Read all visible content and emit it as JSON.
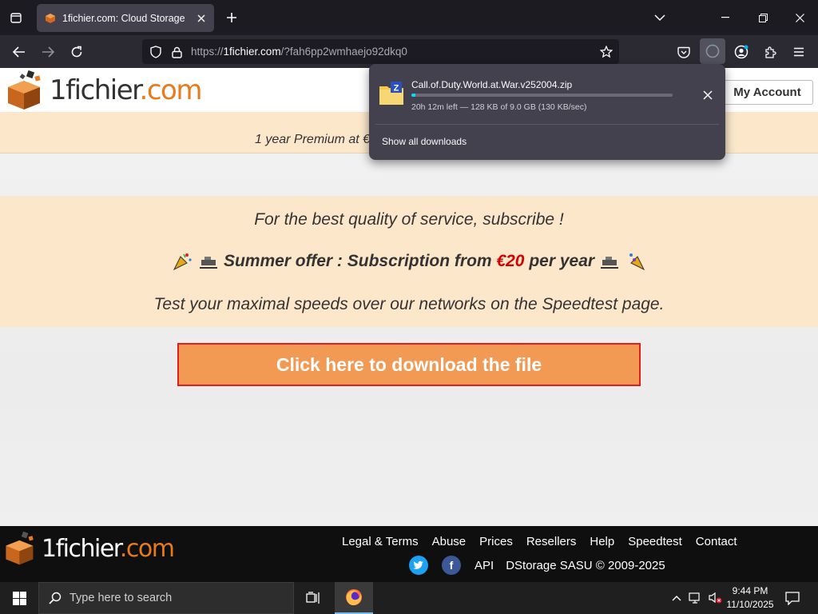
{
  "browser": {
    "tab_title": "1fichier.com: Cloud Storage",
    "url_prefix": "https://",
    "url_host": "1fichier.com",
    "url_path": "/?fah6pp2wmhaejo92dkq0"
  },
  "site": {
    "logo_one": "1",
    "logo_fichier": "fichier",
    "logo_dot": ".",
    "logo_com": "com",
    "my_account": "My Account",
    "promo_strip": "1 year Premium at €",
    "offer_line1": "For the best quality of service, subscribe !",
    "offer_line2_a": "Summer offer : Subscription from ",
    "offer_line2_price": "€20",
    "offer_line2_b": " per year",
    "offer_line3": "Test your maximal speeds over our networks on the Speedtest page.",
    "download_button": "Click here to download the file"
  },
  "footer": {
    "links": [
      "Legal & Terms",
      "Abuse",
      "Prices",
      "Resellers",
      "Help",
      "Speedtest",
      "Contact"
    ],
    "api": "API",
    "copyright": "DStorage SASU © 2009-2025"
  },
  "downloads": {
    "file_name": "Call.of.Duty.World.at.War.v252004.zip",
    "status": "20h 12m left — 128 KB of 9.0 GB (130 KB/sec)",
    "progress_fraction": 0.014,
    "show_all": "Show all downloads"
  },
  "taskbar": {
    "search_placeholder": "Type here to search",
    "time": "9:44 PM",
    "date": "11/10/2025"
  },
  "colors": {
    "accent_orange": "#e87a1c",
    "download_button_bg": "#f29a54",
    "download_button_border": "#e31c1c",
    "promo_bg": "#fce7cb",
    "price_red": "#d40000",
    "progress_blue": "#00ddff"
  }
}
